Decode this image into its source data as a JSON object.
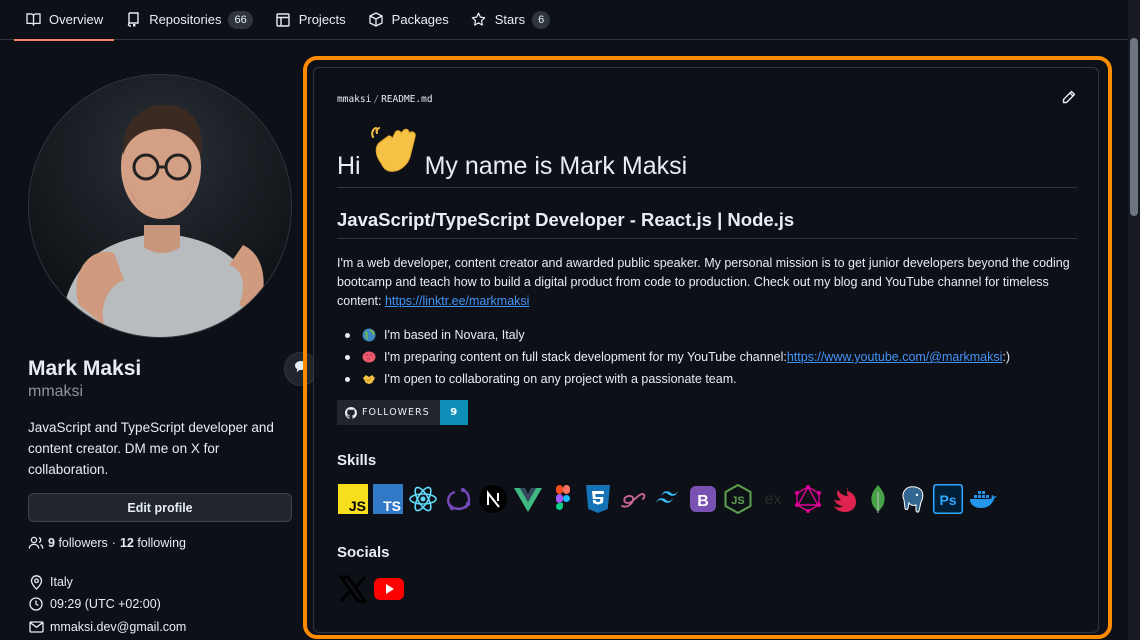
{
  "tabs": [
    {
      "label": "Overview",
      "icon": "book-icon",
      "active": true
    },
    {
      "label": "Repositories",
      "icon": "repo-icon",
      "count": "66"
    },
    {
      "label": "Projects",
      "icon": "table-icon"
    },
    {
      "label": "Packages",
      "icon": "package-icon"
    },
    {
      "label": "Stars",
      "icon": "star-icon",
      "count": "6"
    }
  ],
  "profile": {
    "fullname": "Mark Maksi",
    "username": "mmaksi",
    "bio": "JavaScript and TypeScript developer and content creator. DM me on X for collaboration.",
    "edit_label": "Edit profile",
    "followers_count": "9",
    "followers_label": "followers",
    "separator": "·",
    "following_count": "12",
    "following_label": "following",
    "location": "Italy",
    "time": "09:29 (UTC +02:00)",
    "email": "mmaksi.dev@gmail.com"
  },
  "readme": {
    "owner": "mmaksi",
    "sep": "/",
    "file": "README.md",
    "heading_pre": "Hi",
    "heading_post": "My name is Mark Maksi",
    "subheading": "JavaScript/TypeScript Developer - React.js | Node.js",
    "intro": "I'm a web developer, content creator and awarded public speaker. My personal mission is to get junior developers beyond the coding bootcamp and teach how to build a digital product from code to production. Check out my blog and YouTube channel for timeless content: ",
    "intro_link": "https://linktr.ee/markmaksi",
    "bullets": [
      {
        "emoji": "globe",
        "text": "I'm based in Novara, Italy",
        "link": "",
        "suffix": ""
      },
      {
        "emoji": "brain",
        "text": "I'm preparing content on full stack development for my YouTube channel: ",
        "link": "https://www.youtube.com/@markmaksi",
        "suffix": " :)"
      },
      {
        "emoji": "handshake",
        "text": "I'm open to collaborating on any project with a passionate team.",
        "link": "",
        "suffix": ""
      }
    ],
    "badge_label": "FOLLOWERS",
    "badge_value": "9",
    "skills_title": "Skills",
    "skills": [
      "javascript-icon",
      "typescript-icon",
      "react-icon",
      "redux-icon",
      "nextjs-icon",
      "vue-icon",
      "figma-icon",
      "css3-icon",
      "sass-icon",
      "tailwind-icon",
      "bootstrap-icon",
      "nodejs-icon",
      "express-icon",
      "graphql-icon",
      "nestjs-icon",
      "mongodb-icon",
      "postgresql-icon",
      "photoshop-icon",
      "docker-icon"
    ],
    "socials_title": "Socials",
    "socials": [
      "x-icon",
      "youtube-icon"
    ]
  },
  "colors": {
    "accent": "#f78166",
    "highlight": "#ff8c00",
    "link": "#4493f8",
    "badge": "#0e8fb8"
  }
}
